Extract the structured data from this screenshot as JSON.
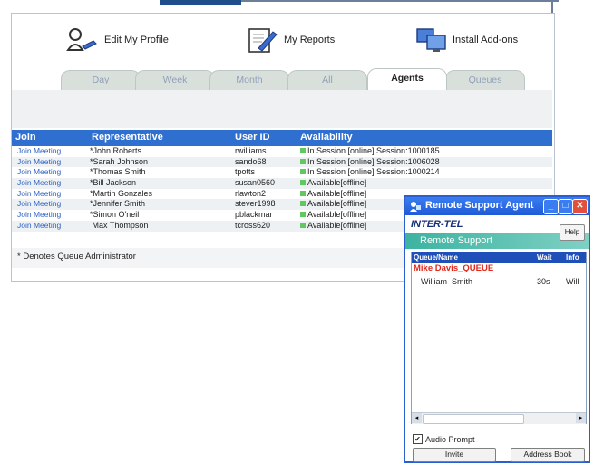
{
  "actions": {
    "edit_profile": "Edit My Profile",
    "my_reports": "My Reports",
    "install_addons": "Install Add-ons"
  },
  "tabs": [
    "Day",
    "Week",
    "Month",
    "All",
    "Agents",
    "Queues"
  ],
  "active_tab": "Agents",
  "table": {
    "headers": [
      "Join",
      "Representative",
      "User ID",
      "Availability"
    ],
    "rows": [
      {
        "join": "Join Meeting",
        "rep": "*John Roberts",
        "user": "rwilliams",
        "avail": "In Session [online] Session:1000185"
      },
      {
        "join": "Join Meeting",
        "rep": "*Sarah Johnson",
        "user": "sando68",
        "avail": "In Session [online] Session:1006028"
      },
      {
        "join": "Join Meeting",
        "rep": "*Thomas Smith",
        "user": "tpotts",
        "avail": "In Session [online] Session:1000214"
      },
      {
        "join": "Join Meeting",
        "rep": "*Bill Jackson",
        "user": "susan0560",
        "avail": "Available[offline]"
      },
      {
        "join": "Join Meeting",
        "rep": "*Martin Gonzales",
        "user": "rlawton2",
        "avail": "Available[offline]"
      },
      {
        "join": "Join Meeting",
        "rep": "*Jennifer Smith",
        "user": "stever1998",
        "avail": "Available[offline]"
      },
      {
        "join": "Join Meeting",
        "rep": "*Simon O'neil",
        "user": "pblackmar",
        "avail": "Available[offline]"
      },
      {
        "join": "Join Meeting",
        "rep": " Max Thompson",
        "user": "tcross620",
        "avail": "Available[offline]"
      }
    ]
  },
  "footnote": "* Denotes Queue Administrator",
  "rsa": {
    "title": "Remote Support Agent",
    "brand": "INTER-TEL",
    "subtitle": "Remote Support",
    "help": "Help",
    "list_headers": [
      "Queue/Name",
      "Wait",
      "Info"
    ],
    "queue_name": "Mike Davis_QUEUE",
    "entry": {
      "name": "William  Smith",
      "wait": "30s",
      "info": "Will"
    },
    "audio_prompt": "Audio Prompt",
    "invite": "Invite",
    "address_book": "Address Book"
  },
  "colors": {
    "header_blue": "#2f6fd0",
    "online_green": "#5fc85f",
    "link_blue": "#2f62c0",
    "queue_red": "#e0281c"
  }
}
